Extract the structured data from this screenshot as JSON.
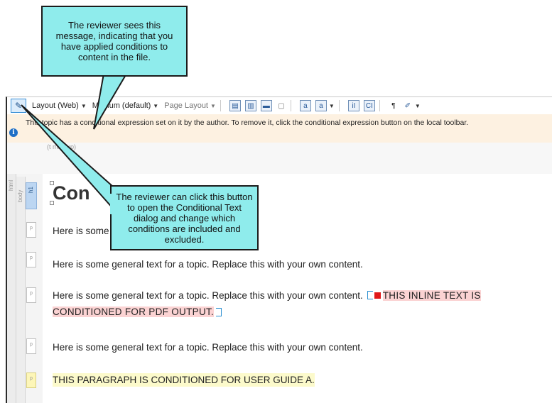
{
  "toolbar": {
    "layout_label": "Layout (Web)",
    "medium_label": "Medium (default)",
    "page_layout_label": "Page Layout",
    "conditional_button_icon": "conditional-expression-icon",
    "icons": [
      "page-icon",
      "page-compare-icon",
      "frame-icon",
      "disabled-page-icon",
      "text-icon",
      "font-icon",
      "i-block-icon",
      "c-block-icon",
      "paragraph-mark-icon",
      "highlighter-icon"
    ]
  },
  "infobar": {
    "message": "This topic has a conditional expression set on it by the author. To remove it, click the conditional expression button on the local toolbar.",
    "markup_note": "(t markup)"
  },
  "structure": {
    "html_label": "html",
    "body_label": "body",
    "h1_label": "h1",
    "p_label": "p"
  },
  "document": {
    "heading": "Con",
    "para1": "Here is some",
    "para2": "Here is some general text for a topic. Replace this with your own content.",
    "para3_text": "Here is some general text for a topic. Replace this with your own content.",
    "para3_inline_cond_line1": "THIS INLINE TEXT IS",
    "para3_inline_cond_line2": "CONDITIONED FOR PDF OUTPUT.",
    "para4": "Here is some general text for a topic. Replace this with your own content.",
    "para5": "THIS PARAGRAPH IS CONDITIONED FOR USER GUIDE A."
  },
  "callouts": {
    "top": "The reviewer sees this message, indicating that you have applied conditions to content in the file.",
    "bottom": "The reviewer can click this button to open the Conditional Text dialog and change which conditions are included and excluded."
  },
  "colors": {
    "callout_fill": "#8fecec",
    "infobar": "#fdf1e1",
    "pink_condition": "#fbd3d3",
    "yellow_condition": "#fcfacb",
    "marker_red": "#e0191b"
  }
}
